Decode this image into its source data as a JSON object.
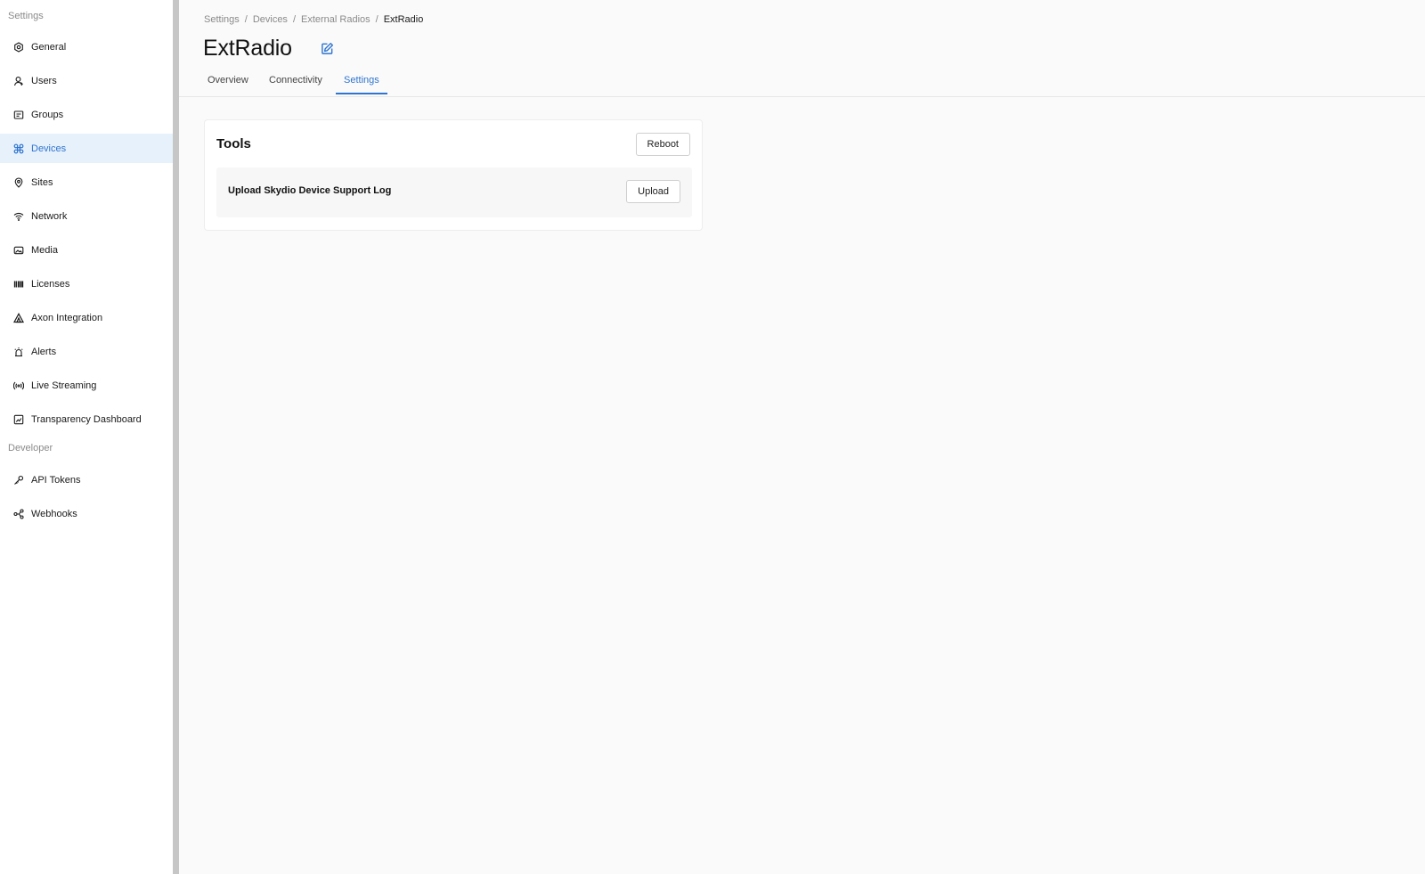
{
  "sidebar": {
    "section_settings": "Settings",
    "section_developer": "Developer",
    "items": [
      {
        "label": "General",
        "icon": "gear-icon"
      },
      {
        "label": "Users",
        "icon": "user-icon"
      },
      {
        "label": "Groups",
        "icon": "groups-icon"
      },
      {
        "label": "Devices",
        "icon": "drone-icon",
        "active": true
      },
      {
        "label": "Sites",
        "icon": "location-pin-icon"
      },
      {
        "label": "Network",
        "icon": "wifi-icon"
      },
      {
        "label": "Media",
        "icon": "media-icon"
      },
      {
        "label": "Licenses",
        "icon": "barcode-icon"
      },
      {
        "label": "Axon Integration",
        "icon": "axon-triangle-icon"
      },
      {
        "label": "Alerts",
        "icon": "siren-icon"
      },
      {
        "label": "Live Streaming",
        "icon": "broadcast-icon"
      },
      {
        "label": "Transparency Dashboard",
        "icon": "dashboard-icon"
      }
    ],
    "developer_items": [
      {
        "label": "API Tokens",
        "icon": "key-icon"
      },
      {
        "label": "Webhooks",
        "icon": "webhook-icon"
      }
    ]
  },
  "breadcrumb": [
    "Settings",
    "Devices",
    "External Radios",
    "ExtRadio"
  ],
  "breadcrumb_separator": "/",
  "page": {
    "title": "ExtRadio",
    "edit_icon": "edit-icon"
  },
  "tabs": [
    {
      "label": "Overview"
    },
    {
      "label": "Connectivity"
    },
    {
      "label": "Settings",
      "active": true
    }
  ],
  "tools_card": {
    "title": "Tools",
    "reboot_label": "Reboot",
    "rows": [
      {
        "label": "Upload Skydio Device Support Log",
        "button_label": "Upload"
      }
    ]
  },
  "colors": {
    "accent": "#2f74d0",
    "active_bg": "#e7f1fb",
    "page_bg": "#fafafa",
    "sidebar_divider": "#c6c6c6"
  }
}
